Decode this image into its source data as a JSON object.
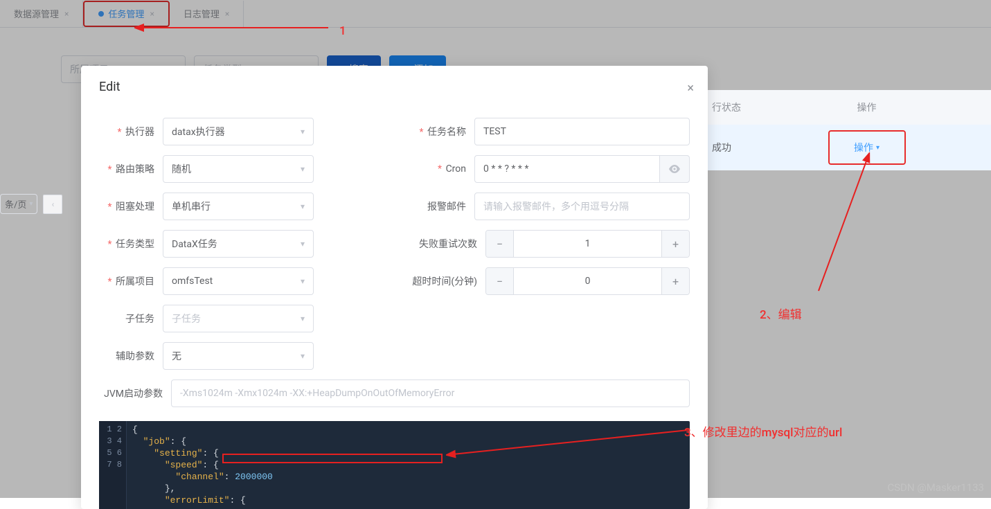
{
  "tabs": {
    "data_source": "数据源管理",
    "task_mgmt": "任务管理",
    "log_mgmt": "日志管理"
  },
  "filters": {
    "project": "所属项目",
    "task_type": "任务类型",
    "search": "搜索",
    "add": "添加"
  },
  "table": {
    "col_state": "行状态",
    "col_op": "操作",
    "row0_state": "成功",
    "row0_op": "操作"
  },
  "pager": {
    "per": "条/页"
  },
  "modal": {
    "title": "Edit",
    "executor_label": "执行器",
    "executor_value": "datax执行器",
    "route_label": "路由策略",
    "route_value": "随机",
    "block_label": "阻塞处理",
    "block_value": "单机串行",
    "task_type_label": "任务类型",
    "task_type_value": "DataX任务",
    "project_label": "所属项目",
    "project_value": "omfsTest",
    "subtask_label": "子任务",
    "subtask_placeholder": "子任务",
    "aux_label": "辅助参数",
    "aux_value": "无",
    "name_label": "任务名称",
    "name_value": "TEST",
    "cron_label": "Cron",
    "cron_value": "0 * * ? * * *",
    "mail_label": "报警邮件",
    "mail_placeholder": "请输入报警邮件，多个用逗号分隔",
    "retry_label": "失败重试次数",
    "retry_value": "1",
    "timeout_label": "超时时间(分钟)",
    "timeout_value": "0",
    "jvm_label": "JVM启动参数",
    "jvm_value": "-Xms1024m -Xmx1024m -XX:+HeapDumpOnOutOfMemoryError"
  },
  "editor": {
    "lines": [
      "1",
      "2",
      "3",
      "4",
      "5",
      "6",
      "7",
      "8"
    ],
    "kw_job": "\"job\"",
    "kw_setting": "\"setting\"",
    "kw_speed": "\"speed\"",
    "kw_channel": "\"channel\"",
    "kw_errorLimit": "\"errorLimit\"",
    "num_channel": "2000000"
  },
  "annotations": {
    "a1": "1",
    "a2": "2、编辑",
    "a3": "3、修改里边的mysql对应的url"
  },
  "watermark": "CSDN @Masker1133"
}
